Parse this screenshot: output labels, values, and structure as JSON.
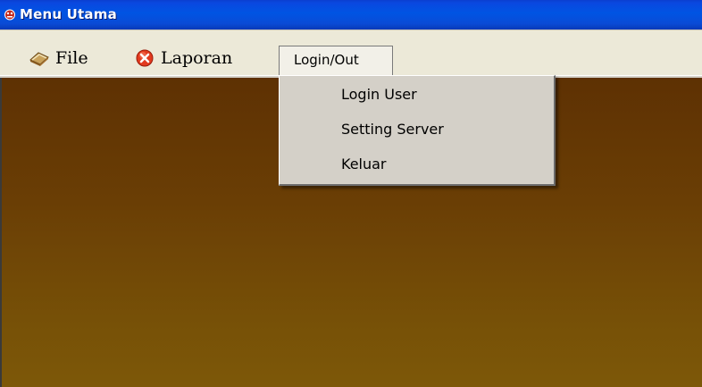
{
  "window": {
    "title": "Menu Utama",
    "icon": "app-bug-icon"
  },
  "menubar": {
    "items": [
      {
        "label": "File",
        "icon": "book-icon"
      },
      {
        "label": "Laporan",
        "icon": "red-x-icon"
      },
      {
        "label": "Login/Out"
      }
    ]
  },
  "dropdown": {
    "items": [
      {
        "label": "Login User"
      },
      {
        "label": "Setting Server"
      },
      {
        "label": "Keluar"
      }
    ]
  },
  "colors": {
    "titlebar": "#0054e3",
    "menubar": "#ece9d8",
    "content_top": "#5e3103",
    "content_bottom": "#7d5808",
    "menu_bg": "#d4d0c8"
  }
}
